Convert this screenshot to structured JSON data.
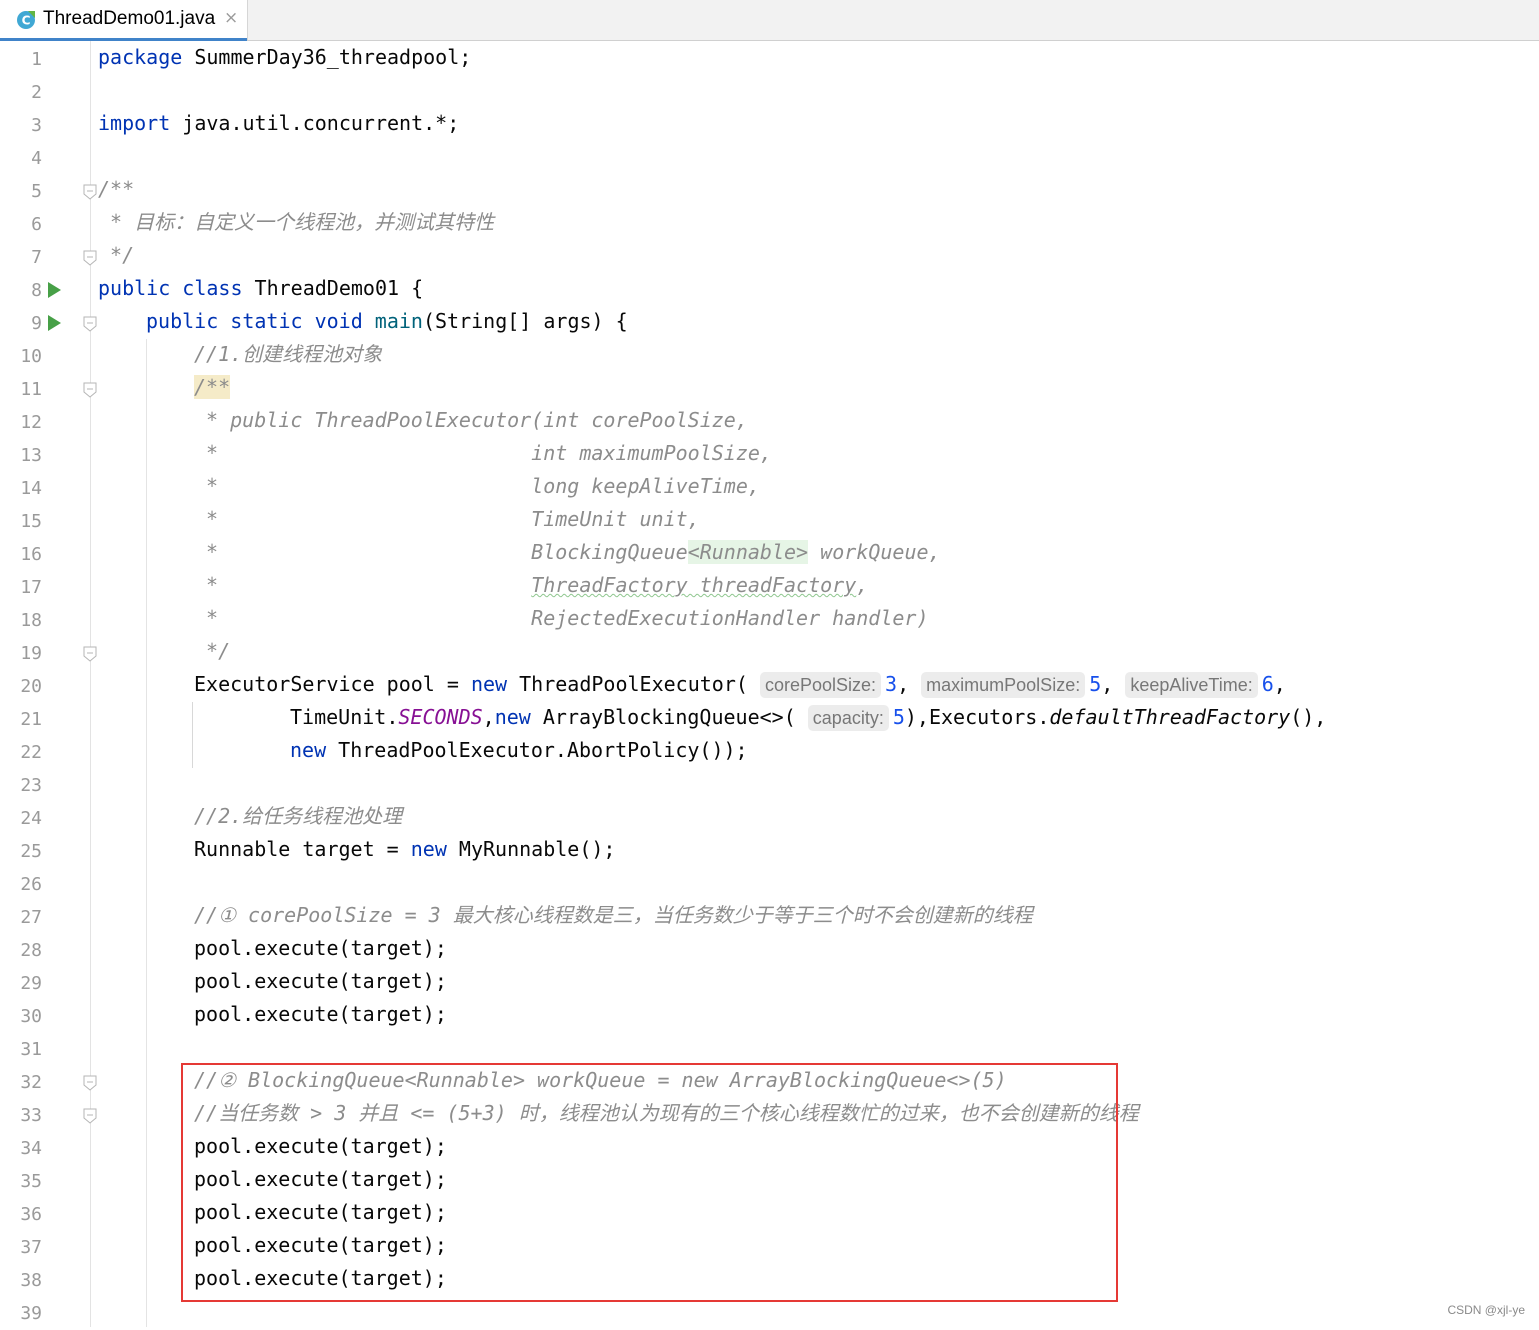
{
  "tab": {
    "filename": "ThreadDemo01.java",
    "close_glyph": "×",
    "icon": "java-class-icon"
  },
  "gutter": {
    "line_numbers": [
      "1",
      "2",
      "3",
      "4",
      "5",
      "6",
      "7",
      "8",
      "9",
      "10",
      "11",
      "12",
      "13",
      "14",
      "15",
      "16",
      "17",
      "18",
      "19",
      "20",
      "21",
      "22",
      "23",
      "24",
      "25",
      "26",
      "27",
      "28",
      "29",
      "30",
      "31",
      "32",
      "33",
      "34",
      "35",
      "36",
      "37",
      "38",
      "39"
    ],
    "run_lines": [
      8,
      9
    ],
    "fold_lines": [
      5,
      7,
      9,
      11,
      19,
      32,
      33
    ]
  },
  "code": {
    "l1": {
      "kw": "package",
      "rest": " SummerDay36_threadpool;"
    },
    "l3": {
      "kw": "import",
      "rest": " java.util.concurrent.*;"
    },
    "l5": "/**",
    "l6": " * 目标：自定义一个线程池，并测试其特性",
    "l7": " */",
    "l8": {
      "kw": "public class",
      "rest": " ThreadDemo01 {"
    },
    "l9": {
      "kw": "public static void",
      "fn": "main",
      "rest": "(String[] args) {"
    },
    "l10": "//1.创建线程池对象",
    "l11": "/**",
    "l12": " * public ThreadPoolExecutor(int corePoolSize,",
    "l13": " *                          int maximumPoolSize,",
    "l14": " *                          long keepAliveTime,",
    "l15": " *                          TimeUnit unit,",
    "l16": {
      "pre": " *                          BlockingQueue",
      "green": "<Runnable>",
      "post": " workQueue,"
    },
    "l17": {
      "pre": " *                          ",
      "squig": "ThreadFactory threadFactory",
      "post": ","
    },
    "l18": " *                          RejectedExecutionHandler handler)",
    "l19": " */",
    "l20": {
      "a": "ExecutorService pool = ",
      "new": "new",
      "b": " ThreadPoolExecutor(",
      "h1": "corePoolSize:",
      "v1": "3",
      "h2": "maximumPoolSize:",
      "v2": "5",
      "h3": "keepAliveTime:",
      "v3": "6"
    },
    "l21": {
      "a": "TimeUnit.",
      "const": "SECONDS",
      "new": "new",
      "b": " ArrayBlockingQueue<>(",
      "h1": "capacity:",
      "v1": "5",
      "c": "),Executors.",
      "it": "defaultThreadFactory",
      "d": "(),"
    },
    "l22": {
      "new": "new",
      "rest": " ThreadPoolExecutor.AbortPolicy());"
    },
    "l24": "//2.给任务线程池处理",
    "l25": {
      "a": "Runnable target = ",
      "new": "new",
      "b": " MyRunnable();"
    },
    "l27": "//① corePoolSize = 3 最大核心线程数是三，当任务数少于等于三个时不会创建新的线程",
    "l28": "pool.execute(target);",
    "l29": "pool.execute(target);",
    "l30": "pool.execute(target);",
    "l32": "//② BlockingQueue<Runnable> workQueue = new ArrayBlockingQueue<>(5)",
    "l33": "//当任务数 > 3 并且 <= (5+3) 时，线程池认为现有的三个核心线程数忙的过来，也不会创建新的线程",
    "l34": "pool.execute(target);",
    "l35": "pool.execute(target);",
    "l36": "pool.execute(target);",
    "l37": "pool.execute(target);",
    "l38": "pool.execute(target);"
  },
  "watermark": "CSDN @xjl-ye",
  "colors": {
    "keyword": "#0033b3",
    "comment": "#8c8c8c",
    "number": "#1750eb",
    "constant": "#871094",
    "highlight_box": "#e53935",
    "run_icon": "#47a047"
  }
}
